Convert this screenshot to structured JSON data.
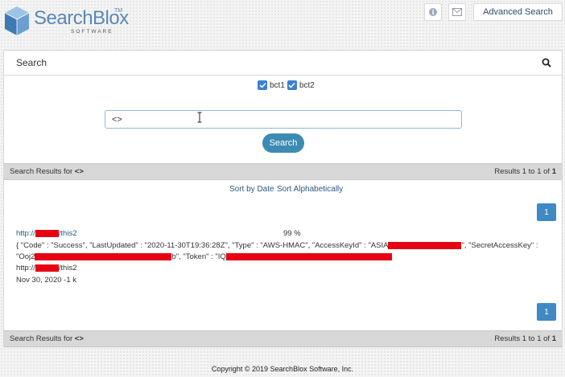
{
  "logo": {
    "text": "SearchBlox",
    "tm": "TM",
    "sub": "SOFTWARE"
  },
  "header": {
    "advanced_search_label": "Advanced Search",
    "icons": [
      "info-icon",
      "mail-icon"
    ]
  },
  "panel": {
    "title": "Search",
    "icon": "search-icon"
  },
  "collections": [
    {
      "label": "bct1",
      "checked": true
    },
    {
      "label": "bct2",
      "checked": true
    }
  ],
  "search": {
    "query": "<>",
    "button_label": "Search"
  },
  "results_bar": {
    "left_prefix": "Search Results for ",
    "query": "<>",
    "right_prefix": "Results 1 to 1 of ",
    "total": "1"
  },
  "sort": {
    "by_date": "Sort by Date",
    "alpha": "Sort Alphabetically"
  },
  "pagination": {
    "page": "1"
  },
  "result": {
    "url_prefix": "http://",
    "url_suffix": "/this2",
    "score": "99 %",
    "desc1": "{ \"Code\" : \"Success\", \"LastUpdated\" : \"2020-11-30T19:36:28Z\", \"Type\" : \"AWS-HMAC\", \"AccessKeyId\" : \"ASIA",
    "desc1_tail": "\", \"SecretAccessKey\" :",
    "desc2_a": "\"Ooj2",
    "desc2_b": "b\", \"Token\" : \"IQ",
    "meta_url_prefix": "http://",
    "meta_url_suffix": "/this2",
    "meta_date": "Nov 30, 2020 -1 k"
  },
  "footer": {
    "copyright": "Copyright © 2019 SearchBlox Software, Inc."
  },
  "colors": {
    "accent": "#3d8bb5",
    "pager": "#3f89c4",
    "redaction": "#e60012",
    "checkbox": "#3c7fd4"
  }
}
